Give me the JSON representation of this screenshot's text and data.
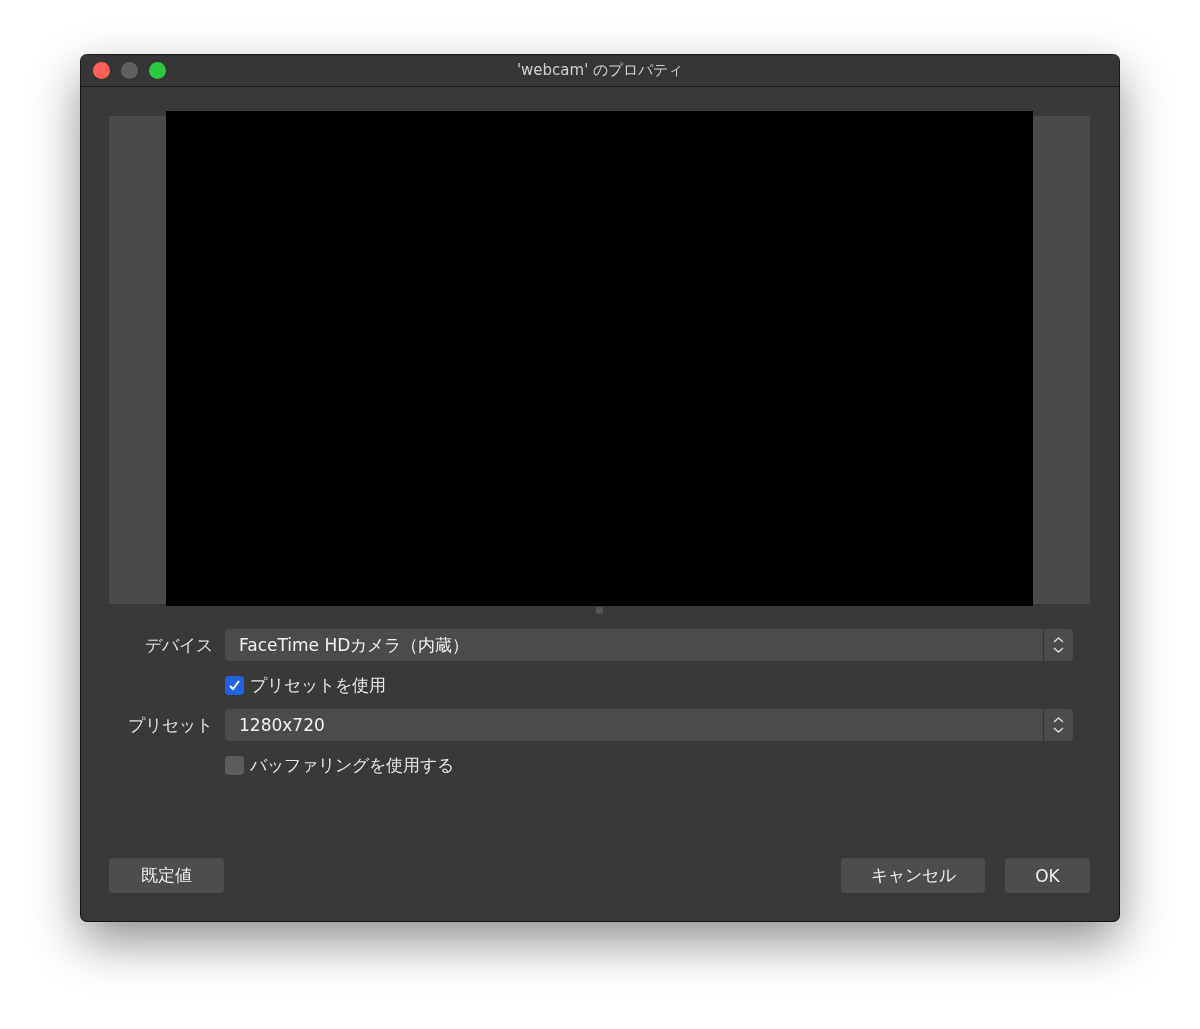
{
  "window": {
    "title": "'webcam' のプロパティ"
  },
  "fields": [
    {
      "kind": "select",
      "label": "デバイス",
      "value": "FaceTime HDカメラ（内蔵）"
    },
    {
      "kind": "checkbox",
      "label": "プリセットを使用",
      "checked": true
    },
    {
      "kind": "select",
      "label": "プリセット",
      "value": "1280x720"
    },
    {
      "kind": "checkbox",
      "label": "バッファリングを使用する",
      "checked": false
    }
  ],
  "buttons": {
    "left": [
      "既定値"
    ],
    "right": [
      "キャンセル",
      "OK"
    ]
  }
}
